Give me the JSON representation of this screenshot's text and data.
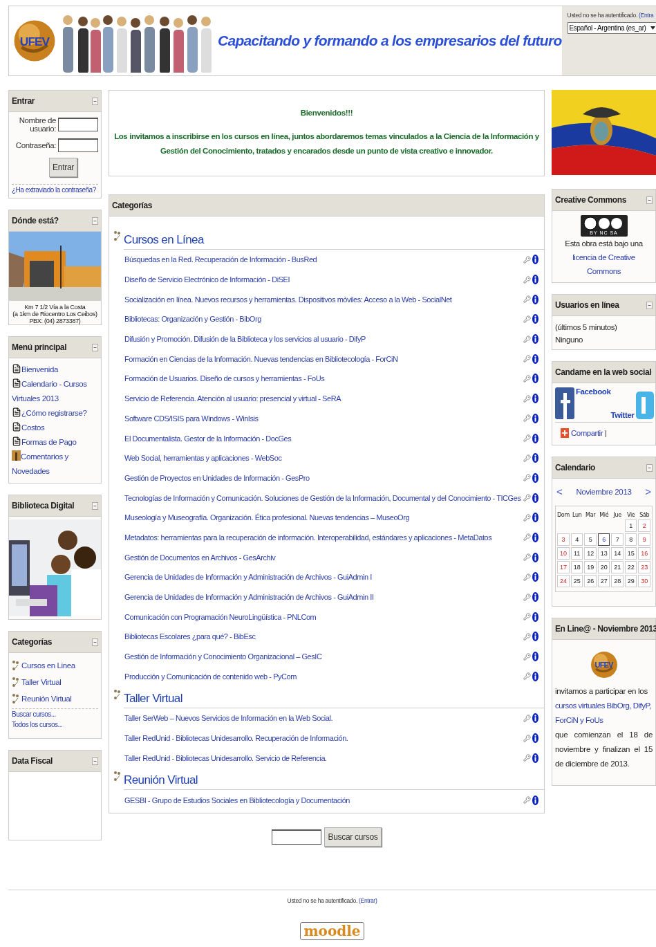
{
  "header": {
    "logo_text": "UFEV",
    "slogan": "Capacitando y formando a los empresarios  del futuro",
    "login_status": "Usted no se ha autentificado.",
    "login_link": "(Entra",
    "language": "Español - Argentina (es_ar)"
  },
  "left_blocks": [
    {
      "kind": "login",
      "title": "Entrar",
      "username_label": "Nombre de usuario:",
      "password_label": "Contraseña:",
      "button": "Entrar",
      "forgot_link": "¿Ha extraviado la contraseña?"
    },
    {
      "kind": "location",
      "title": "Dónde está?",
      "caption": [
        "Km 7 1/2 Vía a la Costa",
        "(a 1km de Riocentro Los Ceibos)",
        "PBX: (04) 2873387)"
      ]
    },
    {
      "kind": "menu",
      "title": "Menú principal",
      "items": [
        {
          "kind": "page",
          "label": "Bienvenida"
        },
        {
          "kind": "page",
          "label": "Calendario - Cursos Virtuales 2013"
        },
        {
          "kind": "page",
          "label": "¿Cómo registrarse?"
        },
        {
          "kind": "page",
          "label": "Costos"
        },
        {
          "kind": "page",
          "label": "Formas de Pago"
        },
        {
          "kind": "forum",
          "label": "Comentarios y Novedades"
        }
      ]
    },
    {
      "kind": "picture",
      "title": "Biblioteca Digital"
    },
    {
      "kind": "categories",
      "title": "Categorías",
      "items": [
        "Cursos en Linea",
        "Taller Virtual",
        "Reunión Virtual"
      ],
      "links": [
        "Buscar cursos...",
        "Todos los cursos..."
      ]
    },
    {
      "kind": "empty",
      "title": "Data Fiscal"
    }
  ],
  "welcome": {
    "title": "Bienvenidos!!!",
    "text": "Los invitamos a inscribirse en los cursos en línea, juntos abordaremos temas vinculados a la Ciencia de la Información y Gestión del Conocimiento, tratados y encarados desde un punto de vista creativo e innovador."
  },
  "categories": {
    "title": "Categorías",
    "groups": [
      {
        "name": "Cursos en Línea",
        "courses": [
          "Búsquedas en la Red. Recuperación de Información - BusRed",
          "Diseño de Servicio Electrónico de Información - DiSEI",
          "Socialización en línea. Nuevos recursos y herramientas. Dispositivos móviles: Acceso a la Web - SocialNet",
          "Bibliotecas: Organización y Gestión - BibOrg",
          "Difusión y Promoción. Difusión de la Biblioteca y los servicios al usuario - DifyP",
          "Formación en Ciencias de la Información. Nuevas tendencias en Bibliotecología - ForCiN",
          "Formación de Usuarios. Diseño de cursos y herramientas - FoUs",
          "Servicio de Referencia. Atención al usuario: presencial y virtual - SeRA",
          "Software CDS/ISIS para Windows - WinIsis",
          "El Documentalista. Gestor de la Información - DocGes",
          "Web Social, herramientas y aplicaciones - WebSoc",
          "Gestión de Proyectos en Unidades de Información - GesPro",
          "Tecnologías de Información y Comunicación. Soluciones de Gestión de la Información, Documental y del Conocimiento - TICGes",
          "Museología y Museografía. Organización. Ética profesional. Nuevas tendencias – MuseoOrg",
          "Metadatos: herramientas para la recuperación de información. Interoperabilidad, estándares y aplicaciones - MetaDatos",
          "Gestión de Documentos en Archivos - GesArchiv",
          "Gerencia de Unidades de Información y Administración de Archivos - GuiAdmin I",
          "Gerencia de Unidades de Información y Administración de Archivos - GuiAdmin II",
          "Comunicación con Programación NeuroLingüística - PNLCom",
          "Bibliotecas Escolares ¿para qué? - BibEsc",
          "Gestión de Información y Conocimiento Organizacional – GesIC",
          "Producción y Comunicación de contenido web - PyCom"
        ]
      },
      {
        "name": "Taller Virtual",
        "courses": [
          "Taller SerWeb – Nuevos Servicios de Información en la Web Social.",
          "Taller RedUnid - Bibliotecas Unidesarrollo. Recuperación de Información.",
          "Taller RedUnid - Bibliotecas Unidesarrollo. Servicio de Referencia."
        ]
      },
      {
        "name": "Reunión Virtual",
        "courses": [
          "GESBI - Grupo de Estudios Sociales en Bibliotecología y Documentación"
        ]
      }
    ]
  },
  "search": {
    "button": "Buscar cursos"
  },
  "right_blocks": [
    {
      "kind": "flag"
    },
    {
      "kind": "license",
      "title": "Creative Commons",
      "badge_label": "BY NC SA",
      "text": "Esta obra está bajo una ",
      "link": "licencia de Creative Commons"
    },
    {
      "kind": "online",
      "title": "Usuarios en línea",
      "period": "(últimos 5 minutos)",
      "users": "Ninguno"
    },
    {
      "kind": "social",
      "title": "Candame en la web social",
      "facebook": "Facebook",
      "twitter": "Twitter",
      "share": "Compartir",
      "separator": "|"
    },
    {
      "kind": "calendar",
      "title": "Calendario",
      "prev": "<",
      "month": "Noviembre 2013",
      "next": ">",
      "weekdays": [
        "Dom",
        "Lun",
        "Mar",
        "Mié",
        "Jue",
        "Vie",
        "Sáb"
      ],
      "weeks": [
        [
          {
            "kind": "empty"
          },
          {
            "kind": "empty"
          },
          {
            "kind": "empty"
          },
          {
            "kind": "empty"
          },
          {
            "kind": "empty"
          },
          {
            "kind": "day",
            "day": "1",
            "today": false
          },
          {
            "kind": "day",
            "day": "2",
            "today": false
          }
        ],
        [
          {
            "kind": "day",
            "day": "3",
            "today": false
          },
          {
            "kind": "day",
            "day": "4",
            "today": false
          },
          {
            "kind": "day",
            "day": "5",
            "today": false
          },
          {
            "kind": "day",
            "day": "6",
            "today": true
          },
          {
            "kind": "day",
            "day": "7",
            "today": false
          },
          {
            "kind": "day",
            "day": "8",
            "today": false
          },
          {
            "kind": "day",
            "day": "9",
            "today": false
          }
        ],
        [
          {
            "kind": "day",
            "day": "10",
            "today": false
          },
          {
            "kind": "day",
            "day": "11",
            "today": false
          },
          {
            "kind": "day",
            "day": "12",
            "today": false
          },
          {
            "kind": "day",
            "day": "13",
            "today": false
          },
          {
            "kind": "day",
            "day": "14",
            "today": false
          },
          {
            "kind": "day",
            "day": "15",
            "today": false
          },
          {
            "kind": "day",
            "day": "16",
            "today": false
          }
        ],
        [
          {
            "kind": "day",
            "day": "17",
            "today": false
          },
          {
            "kind": "day",
            "day": "18",
            "today": false
          },
          {
            "kind": "day",
            "day": "19",
            "today": false
          },
          {
            "kind": "day",
            "day": "20",
            "today": false
          },
          {
            "kind": "day",
            "day": "21",
            "today": false
          },
          {
            "kind": "day",
            "day": "22",
            "today": false
          },
          {
            "kind": "day",
            "day": "23",
            "today": false
          }
        ],
        [
          {
            "kind": "day",
            "day": "24",
            "today": false
          },
          {
            "kind": "day",
            "day": "25",
            "today": false
          },
          {
            "kind": "day",
            "day": "26",
            "today": false
          },
          {
            "kind": "day",
            "day": "27",
            "today": false
          },
          {
            "kind": "day",
            "day": "28",
            "today": false
          },
          {
            "kind": "day",
            "day": "29",
            "today": false
          },
          {
            "kind": "day",
            "day": "30",
            "today": false
          }
        ]
      ]
    },
    {
      "kind": "news",
      "title": "En Line@ - Noviembre 2013",
      "logo_text": "UFEV",
      "text_before": "invitamos a participar en los ",
      "link": "cursos virtuales BibOrg, DifyP, ForCiN y FoUs",
      "text_after": " que comienzan el 18 de noviembre y finalizan el 15 de diciembre de 2013."
    }
  ],
  "footer": {
    "status": "Usted no se ha autentificado.",
    "link": "(Entrar)",
    "logo": "moodle"
  }
}
